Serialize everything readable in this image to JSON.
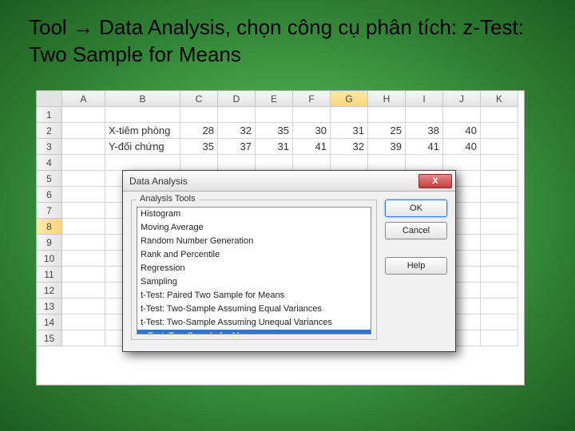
{
  "instruction": "Tool → Data Analysis, chọn công cụ phân tích: z-Test: Two Sample for Means",
  "columns": [
    "A",
    "B",
    "C",
    "D",
    "E",
    "F",
    "G",
    "H",
    "I",
    "J",
    "K"
  ],
  "rows": [
    "1",
    "2",
    "3",
    "4",
    "5",
    "6",
    "7",
    "8",
    "9",
    "10",
    "11",
    "12",
    "13",
    "14",
    "15"
  ],
  "selected_col": "G",
  "selected_row": "8",
  "sheet": {
    "B2": "X-tiêm phòng",
    "C2": "28",
    "D2": "32",
    "E2": "35",
    "F2": "30",
    "G2": "31",
    "H2": "25",
    "I2": "38",
    "J2": "40",
    "B3": "Y-đối chứng",
    "C3": "35",
    "D3": "37",
    "E3": "31",
    "F3": "41",
    "G3": "32",
    "H3": "39",
    "I3": "41",
    "J3": "40"
  },
  "dialog": {
    "title": "Data Analysis",
    "group_label": "Analysis Tools",
    "items": [
      "Histogram",
      "Moving Average",
      "Random Number Generation",
      "Rank and Percentile",
      "Regression",
      "Sampling",
      "t-Test: Paired Two Sample for Means",
      "t-Test: Two-Sample Assuming Equal Variances",
      "t-Test: Two-Sample Assuming Unequal Variances",
      "z-Test: Two Sample for Means"
    ],
    "selected_index": 9,
    "buttons": {
      "ok": "OK",
      "cancel": "Cancel",
      "help": "Help"
    },
    "close": "X"
  }
}
